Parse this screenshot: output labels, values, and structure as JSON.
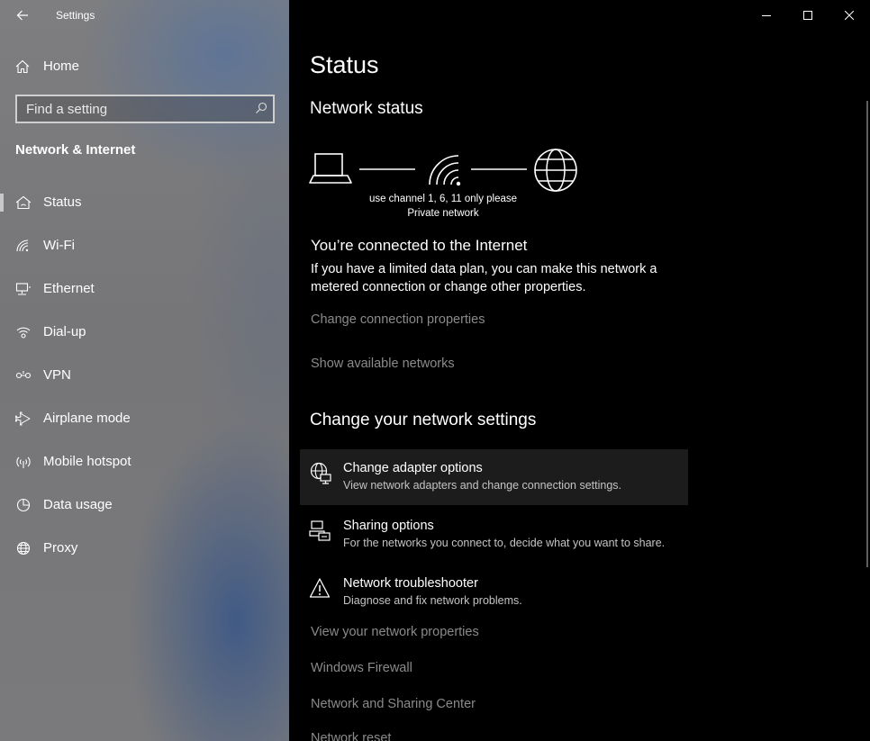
{
  "window": {
    "title": "Settings"
  },
  "sidebar": {
    "home_label": "Home",
    "search_placeholder": "Find a setting",
    "section_title": "Network & Internet",
    "items": [
      {
        "label": "Status",
        "icon": "home-status-icon"
      },
      {
        "label": "Wi-Fi",
        "icon": "wifi-icon"
      },
      {
        "label": "Ethernet",
        "icon": "ethernet-icon"
      },
      {
        "label": "Dial-up",
        "icon": "dialup-icon"
      },
      {
        "label": "VPN",
        "icon": "vpn-icon"
      },
      {
        "label": "Airplane mode",
        "icon": "airplane-icon"
      },
      {
        "label": "Mobile hotspot",
        "icon": "hotspot-icon"
      },
      {
        "label": "Data usage",
        "icon": "data-usage-icon"
      },
      {
        "label": "Proxy",
        "icon": "globe-icon"
      }
    ],
    "selected": "Status"
  },
  "main": {
    "title": "Status",
    "network_status_title": "Network status",
    "network_name": "use channel 1, 6, 11 only please",
    "network_type": "Private network",
    "connected_heading": "You’re connected to the Internet",
    "connected_desc": "If you have a limited data plan, you can make this network a metered connection or change other properties.",
    "change_connection_link": "Change connection properties",
    "show_networks_link": "Show available networks",
    "change_settings_title": "Change your network settings",
    "options": [
      {
        "title": "Change adapter options",
        "desc": "View network adapters and change connection settings.",
        "icon": "adapter-icon"
      },
      {
        "title": "Sharing options",
        "desc": "For the networks you connect to, decide what you want to share.",
        "icon": "sharing-icon"
      },
      {
        "title": "Network troubleshooter",
        "desc": "Diagnose and fix network problems.",
        "icon": "warning-icon"
      }
    ],
    "links": [
      "View your network properties",
      "Windows Firewall",
      "Network and Sharing Center",
      "Network reset"
    ]
  },
  "colors": {
    "background": "#000000",
    "sidebar": "#7a7a7c",
    "link": "#8a8a8a",
    "text": "#ffffff"
  }
}
